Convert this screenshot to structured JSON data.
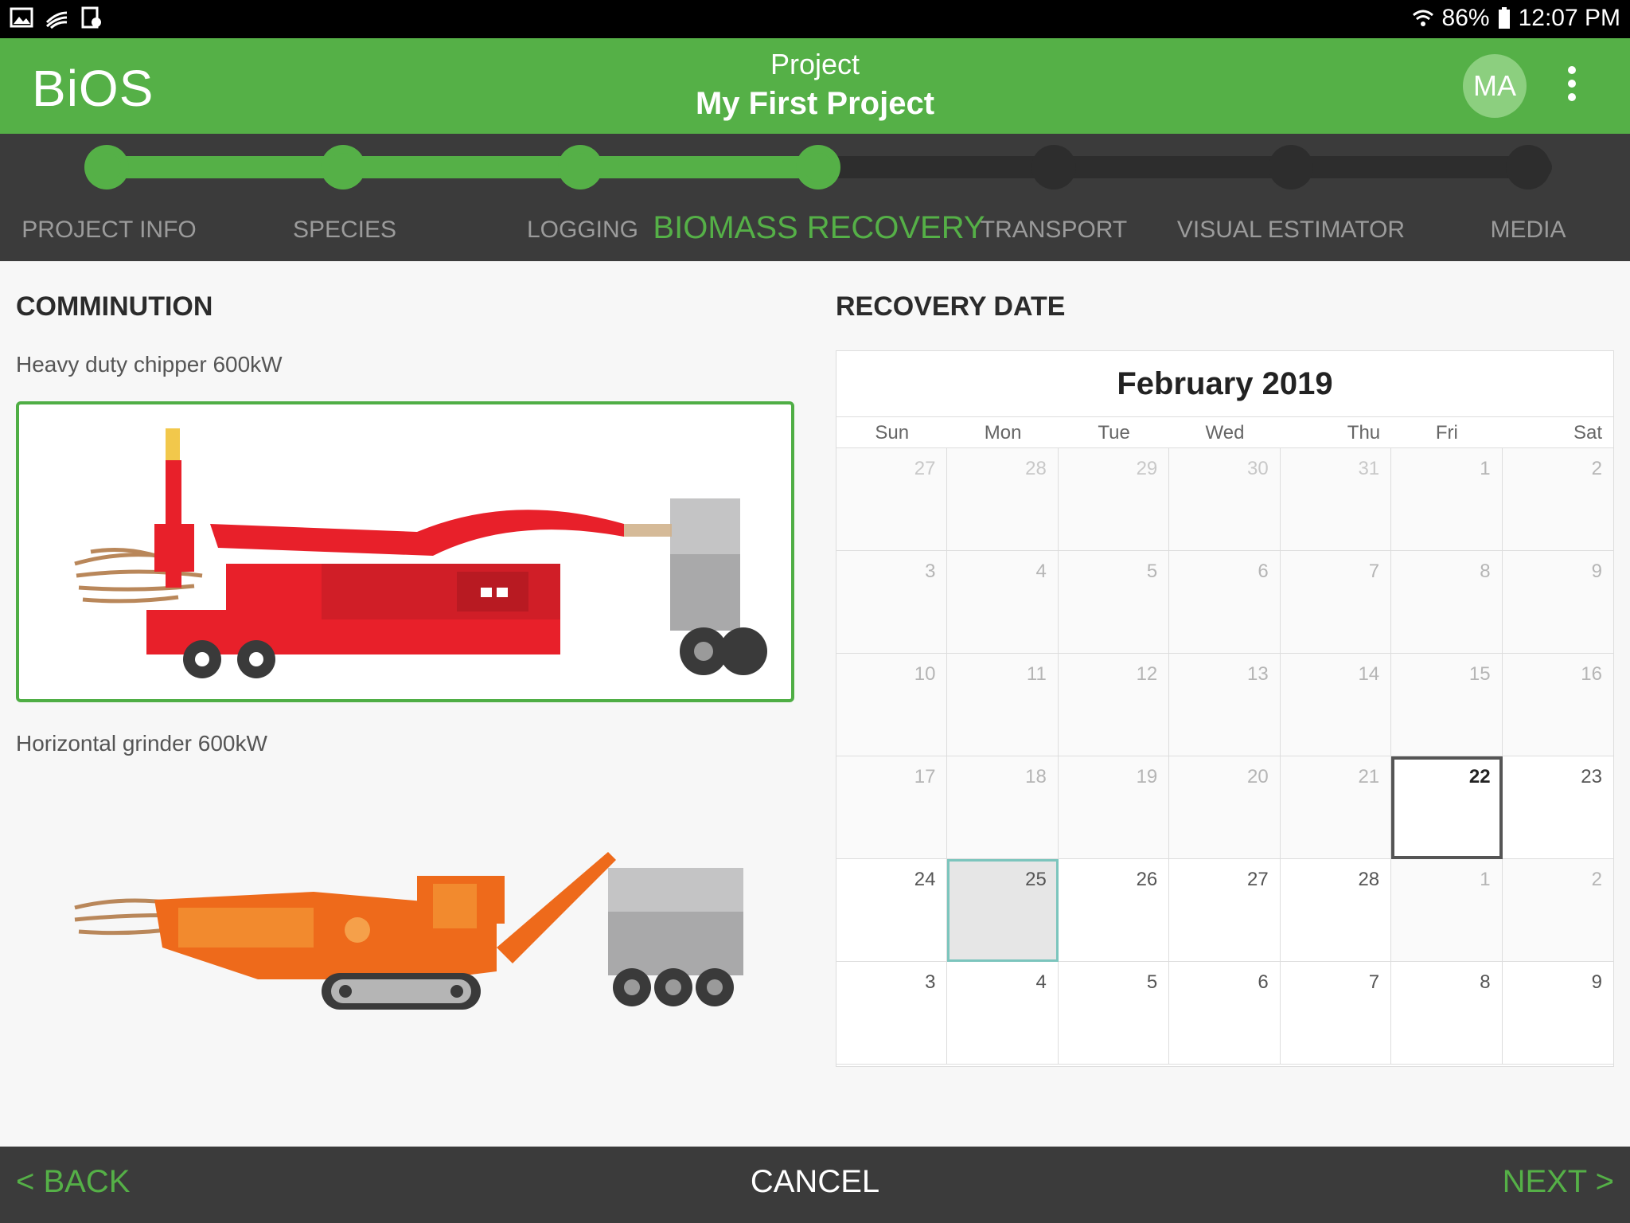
{
  "status": {
    "battery": "86%",
    "time": "12:07 PM"
  },
  "appbar": {
    "brand": "BiOS",
    "project_label": "Project",
    "project_name": "My First Project",
    "avatar_initials": "MA"
  },
  "steps": [
    {
      "label": "PROJECT INFO",
      "state": "done"
    },
    {
      "label": "SPECIES",
      "state": "done"
    },
    {
      "label": "LOGGING",
      "state": "done"
    },
    {
      "label": "BIOMASS RECOVERY",
      "state": "active"
    },
    {
      "label": "TRANSPORT",
      "state": "todo"
    },
    {
      "label": "VISUAL ESTIMATOR",
      "state": "todo"
    },
    {
      "label": "MEDIA",
      "state": "todo"
    }
  ],
  "comminution": {
    "title": "COMMINUTION",
    "options": [
      {
        "label": "Heavy duty chipper 600kW",
        "selected": true
      },
      {
        "label": "Horizontal grinder 600kW",
        "selected": false
      }
    ]
  },
  "recovery": {
    "title": "RECOVERY DATE",
    "month": "February 2019",
    "weekdays": [
      "Sun",
      "Mon",
      "Tue",
      "Wed",
      "Thu",
      "Fri",
      "Sat"
    ],
    "days": [
      "27",
      "28",
      "29",
      "30",
      "31",
      "1",
      "2",
      "3",
      "4",
      "5",
      "6",
      "7",
      "8",
      "9",
      "10",
      "11",
      "12",
      "13",
      "14",
      "15",
      "16",
      "17",
      "18",
      "19",
      "20",
      "21",
      "22",
      "23",
      "24",
      "25",
      "26",
      "27",
      "28",
      "1",
      "2",
      "3",
      "4",
      "5",
      "6",
      "7",
      "8",
      "9"
    ],
    "today": "22",
    "selected": "25"
  },
  "footer": {
    "back": "< BACK",
    "cancel": "CANCEL",
    "next": "NEXT >"
  },
  "colors": {
    "brand_green": "#55b047",
    "chipper_red": "#e8202a",
    "grinder_orange": "#ee6a1b"
  }
}
